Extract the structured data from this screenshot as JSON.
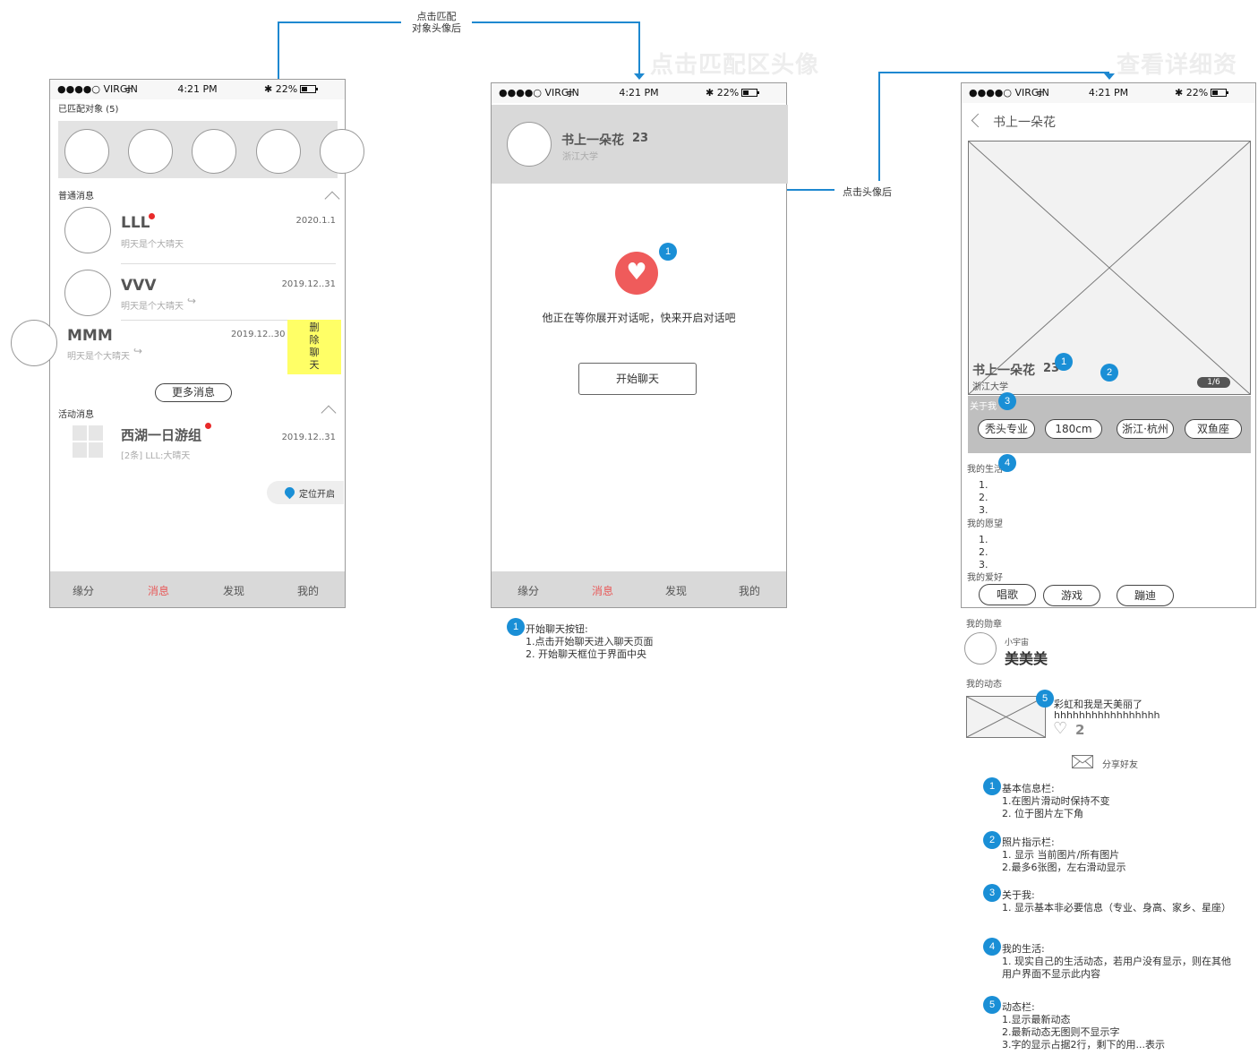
{
  "colors": {
    "accent_blue": "#1e88d0",
    "badge_blue": "#1a8fd6",
    "heart_red": "#ef5b5b",
    "active_tab": "#e85a5a",
    "sticky_yellow": "#ffff66"
  },
  "flow": {
    "label_tap_avatar_1": "点击匹配",
    "label_tap_avatar_2": "对象头像后",
    "label_tap_head": "点击头像后",
    "title_screen2": "点击匹配区头像",
    "title_screen3": "查看详细资料"
  },
  "statusbar": {
    "carrier": "●●●●○ VIRGIN",
    "time": "4:21 PM",
    "battery": "22%"
  },
  "tabs": [
    "缘分",
    "消息",
    "发现",
    "我的"
  ],
  "screen1": {
    "matched_label": "已匹配对象 (5)",
    "normal_label": "普通消息",
    "messages": [
      {
        "name": "LLL",
        "date": "2020.1.1",
        "preview": "明天是个大晴天"
      },
      {
        "name": "VVV",
        "date": "2019.12..31",
        "preview": "明天是个大晴天"
      },
      {
        "name": "MMM",
        "date": "2019.12..30",
        "preview": "明天是个大晴天"
      }
    ],
    "delete_label": "删\n除\n聊\n天",
    "more_button": "更多消息",
    "activity_label": "活动消息",
    "activity": {
      "name": "西湖一日游组",
      "date": "2019.12..31",
      "preview": "[2条] LLL:大晴天"
    },
    "location_button": "定位开启"
  },
  "screen2": {
    "name": "书上一朵花",
    "age": "23",
    "school": "浙江大学",
    "waiting_text": "他正在等你展开对话呢，快来开启对话吧",
    "start_button": "开始聊天",
    "badge": "1",
    "notes": [
      "开始聊天按钮:",
      "1.点击开始聊天进入聊天页面",
      "2. 开始聊天框位于界面中央"
    ]
  },
  "screen3": {
    "back_title": "书上一朵花",
    "name": "书上一朵花",
    "age": "23",
    "school": "浙江大学",
    "photo_index": "1/6",
    "about_label": "关于我",
    "about_tags": [
      "秃头专业",
      "180cm",
      "浙江·杭州",
      "双鱼座"
    ],
    "life_label": "我的生活",
    "life_items": [
      "1.",
      "2.",
      "3."
    ],
    "wish_label": "我的愿望",
    "wish_items": [
      "1.",
      "2.",
      "3."
    ],
    "hobby_label": "我的爱好",
    "hobbies": [
      "唱歌",
      "游戏",
      "蹦迪"
    ],
    "medal_label": "我的勋章",
    "medal_small": "小宇宙",
    "medal_name": "美美美",
    "moments_label": "我的动态",
    "moment_text_1": "彩虹和我是天美丽了",
    "moment_text_2": "hhhhhhhhhhhhhhhhh",
    "moment_likes": "2",
    "share_label": "分享好友",
    "badges": [
      "1",
      "2",
      "3",
      "4",
      "5"
    ],
    "notes": [
      {
        "num": "1",
        "lines": [
          "基本信息栏:",
          "1.在图片滑动时保持不变",
          "2. 位于图片左下角"
        ]
      },
      {
        "num": "2",
        "lines": [
          "照片指示栏:",
          "1. 显示 当前图片/所有图片",
          "2.最多6张图，左右滑动显示"
        ]
      },
      {
        "num": "3",
        "lines": [
          "关于我:",
          "1. 显示基本非必要信息（专业、身高、家乡、星座）"
        ]
      },
      {
        "num": "4",
        "lines": [
          "我的生活:",
          "1. 现实自己的生活动态，若用户没有显示，则在其他",
          "用户界面不显示此内容"
        ]
      },
      {
        "num": "5",
        "lines": [
          "动态栏:",
          "1.显示最新动态",
          "2.最新动态无图则不显示字",
          "3.字的显示占据2行，剩下的用...表示"
        ]
      }
    ]
  }
}
